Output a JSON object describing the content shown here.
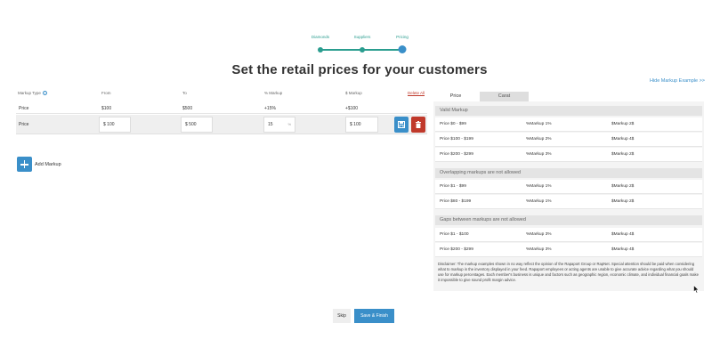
{
  "stepper": {
    "steps": [
      {
        "label": "Diamonds"
      },
      {
        "label": "Suppliers"
      },
      {
        "label": "Pricing"
      }
    ]
  },
  "page_title": "Set the retail prices for your customers",
  "hide_link": "Hide Markup Example >>",
  "table": {
    "headers": {
      "markup_type": "Markup Type",
      "from": "From",
      "to": "To",
      "pct_markup": "% Markup",
      "dollar_markup": "$ Markup",
      "delete_all": "Delete All"
    },
    "info_icon": "i",
    "row1": {
      "type": "Price",
      "from": "$100",
      "to": "$500",
      "pct": "+15%",
      "dollar": "+$100"
    },
    "row2": {
      "type": "Price",
      "from_prefix": "$",
      "from_value": "100",
      "to_prefix": "$",
      "to_value": "500",
      "pct_value": "15",
      "pct_suffix": "%",
      "dollar_prefix": "$",
      "dollar_value": "100"
    }
  },
  "add_markup_label": "Add Markup",
  "tabs": {
    "active": "Price",
    "inactive": "Carat"
  },
  "panel": {
    "valid": {
      "title": "Valid Markup",
      "rows": [
        {
          "range": "Price $0 - $99",
          "pct": "%Markup 1%",
          "dollar": "$Markup 2$"
        },
        {
          "range": "Price $100 - $199",
          "pct": "%Markup 2%",
          "dollar": "$Markup 4$"
        },
        {
          "range": "Price $200 - $299",
          "pct": "%Markup 3%",
          "dollar": "$Markup 2$"
        }
      ]
    },
    "overlap": {
      "title": "Overlapping markups are not allowed",
      "rows": [
        {
          "range": "Price $1 - $99",
          "pct": "%Markup 1%",
          "dollar": "$Markup 2$"
        },
        {
          "range": "Price $80 - $199",
          "pct": "%Markup 1%",
          "dollar": "$Markup 2$"
        }
      ]
    },
    "gaps": {
      "title": "Gaps between markups are not allowed",
      "rows": [
        {
          "range": "Price $1 - $100",
          "pct": "%Markup 3%",
          "dollar": "$Markup 4$"
        },
        {
          "range": "Price $200 - $299",
          "pct": "%Markup 3%",
          "dollar": "$Markup 4$"
        }
      ]
    },
    "disclaimer": "Disclaimer: The markup examples shown in no way reflect the opinion of the Rapaport Group or RapNet. Special attention should be paid when considering what to markup in the inventory displayed in your feed. Rapaport employees or acting agents are unable to give accurate advice regarding what you should use for markup percentages. Each member's business is unique and factors such as geographic region, economic climate, and individual financial goals make it impossible to give sound profit margin advice."
  },
  "buttons": {
    "skip": "Skip",
    "finish": "Save & Finish"
  },
  "colors": {
    "accent": "#3a8fc9",
    "teal": "#2a9d8f",
    "danger": "#c0392b"
  }
}
